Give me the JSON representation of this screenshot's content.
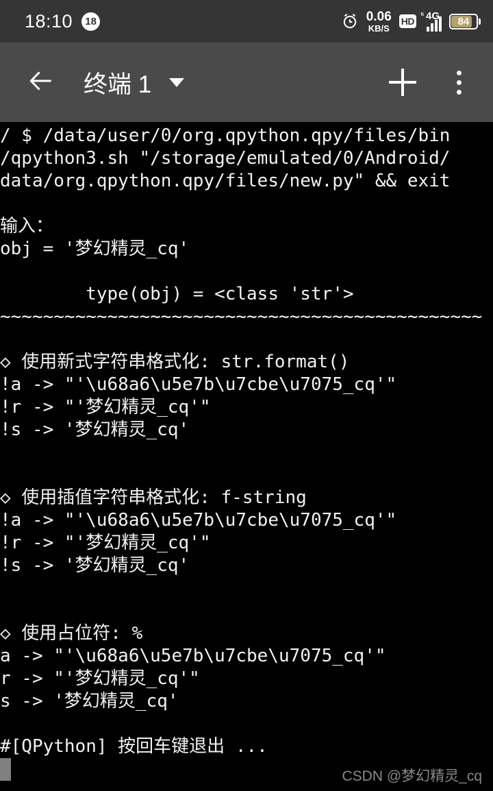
{
  "status_bar": {
    "time": "18:10",
    "notification_count": "18",
    "alarm_icon": "alarm-clock-icon",
    "net_speed_value": "0.06",
    "net_speed_unit": "KB/S",
    "hd_label": "HD",
    "network_type": "4G",
    "battery_percent": "84",
    "background_color": "#353535"
  },
  "app_bar": {
    "back_icon": "back-arrow-icon",
    "title": "终端 1",
    "dropdown_icon": "chevron-down-icon",
    "add_icon": "plus-icon",
    "overflow_icon": "more-vertical-icon",
    "background_color": "#4a4a4a"
  },
  "terminal": {
    "background_color": "#000000",
    "text_color": "#f2f2f2",
    "cursor_color": "#808080",
    "lines": [
      "/ $ /data/user/0/org.qpython.qpy/files/bin",
      "/qpython3.sh \"/storage/emulated/0/Android/",
      "data/org.qpython.qpy/files/new.py\" && exit",
      "",
      "输入：",
      "obj = '梦幻精灵_cq'",
      "",
      "        type(obj) = <class 'str'>",
      "~~~~~~~~~~~~~~~~~~~~~~~~~~~~~~~~~~~~~~~~~~~~~",
      "",
      "◇ 使用新式字符串格式化: str.format()",
      "!a -> \"'\\u68a6\\u5e7b\\u7cbe\\u7075_cq'\"",
      "!r -> \"'梦幻精灵_cq'\"",
      "!s -> '梦幻精灵_cq'",
      "",
      "",
      "◇ 使用插值字符串格式化: f-string",
      "!a -> \"'\\u68a6\\u5e7b\\u7cbe\\u7075_cq'\"",
      "!r -> \"'梦幻精灵_cq'\"",
      "!s -> '梦幻精灵_cq'",
      "",
      "",
      "◇ 使用占位符: %",
      "a -> \"'\\u68a6\\u5e7b\\u7cbe\\u7075_cq'\"",
      "r -> \"'梦幻精灵_cq'\"",
      "s -> '梦幻精灵_cq'",
      "",
      "#[QPython] 按回车键退出 ..."
    ]
  },
  "watermark": {
    "text": "CSDN @梦幻精灵_cq",
    "color": "#8a8a8a"
  }
}
